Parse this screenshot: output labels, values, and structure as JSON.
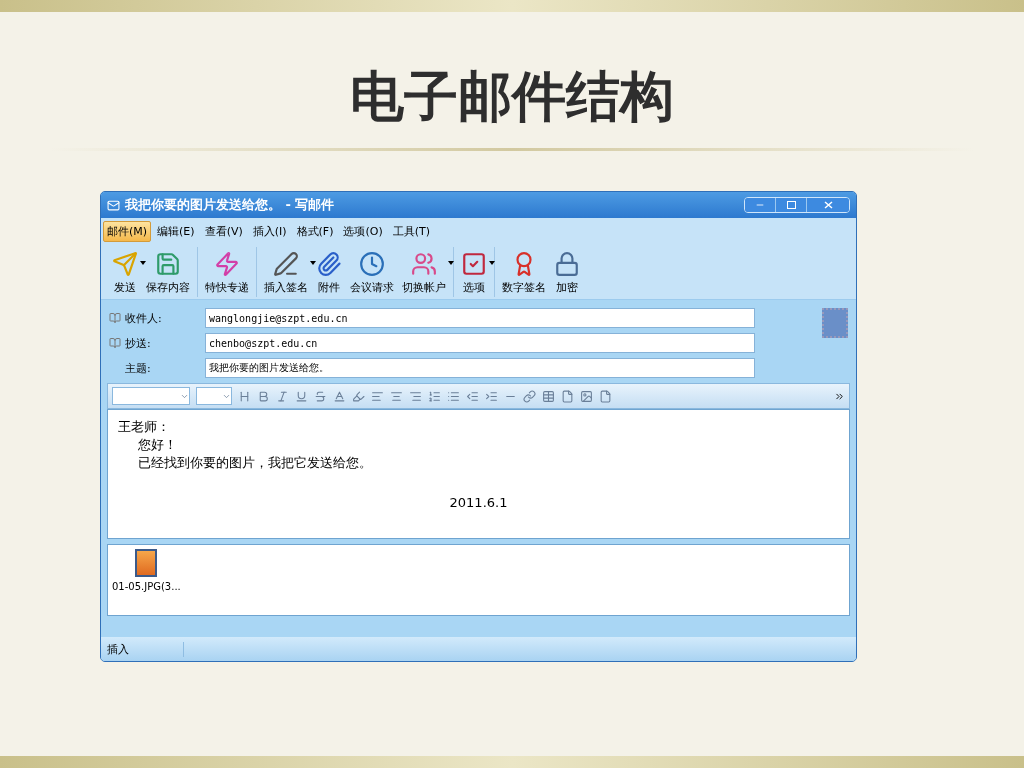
{
  "slide": {
    "title": "电子邮件结构"
  },
  "window": {
    "title": "我把你要的图片发送给您。 - 写邮件"
  },
  "menu": [
    {
      "label": "邮件(M)",
      "selected": true
    },
    {
      "label": "编辑(E)",
      "selected": false
    },
    {
      "label": "查看(V)",
      "selected": false
    },
    {
      "label": "插入(I)",
      "selected": false
    },
    {
      "label": "格式(F)",
      "selected": false
    },
    {
      "label": "选项(O)",
      "selected": false
    },
    {
      "label": "工具(T)",
      "selected": false
    }
  ],
  "toolbar": [
    [
      {
        "label": "发送",
        "kind": "send",
        "has_menu": true
      },
      {
        "label": "保存内容",
        "kind": "save",
        "has_menu": false
      }
    ],
    [
      {
        "label": "特快专递",
        "kind": "express",
        "has_menu": false
      }
    ],
    [
      {
        "label": "插入签名",
        "kind": "signature",
        "has_menu": true
      },
      {
        "label": "附件",
        "kind": "attach",
        "has_menu": false
      },
      {
        "label": "会议请求",
        "kind": "meeting",
        "has_menu": false
      },
      {
        "label": "切换帐户",
        "kind": "accounts",
        "has_menu": true
      }
    ],
    [
      {
        "label": "选项",
        "kind": "options",
        "has_menu": true
      }
    ],
    [
      {
        "label": "数字签名",
        "kind": "cert",
        "has_menu": false
      },
      {
        "label": "加密",
        "kind": "encrypt",
        "has_menu": false
      }
    ]
  ],
  "fields": [
    {
      "label": "收件人:",
      "value": "wanglongjie@szpt.edu.cn",
      "address_book": true
    },
    {
      "label": "抄送:",
      "value": "chenbo@szpt.edu.cn",
      "address_book": true
    },
    {
      "label": "主题:",
      "value": "我把你要的图片发送给您。",
      "address_book": false
    }
  ],
  "body": [
    {
      "text": "王老师：",
      "kind": "plain"
    },
    {
      "text": "您好！",
      "kind": "indented"
    },
    {
      "text": "已经找到你要的图片，我把它发送给您。",
      "kind": "indented"
    },
    {
      "text": "2011.6.1",
      "kind": "centered"
    }
  ],
  "attachments": [
    {
      "name": "01-05.JPG(3..."
    }
  ],
  "status_bar": {
    "text": "插入"
  }
}
